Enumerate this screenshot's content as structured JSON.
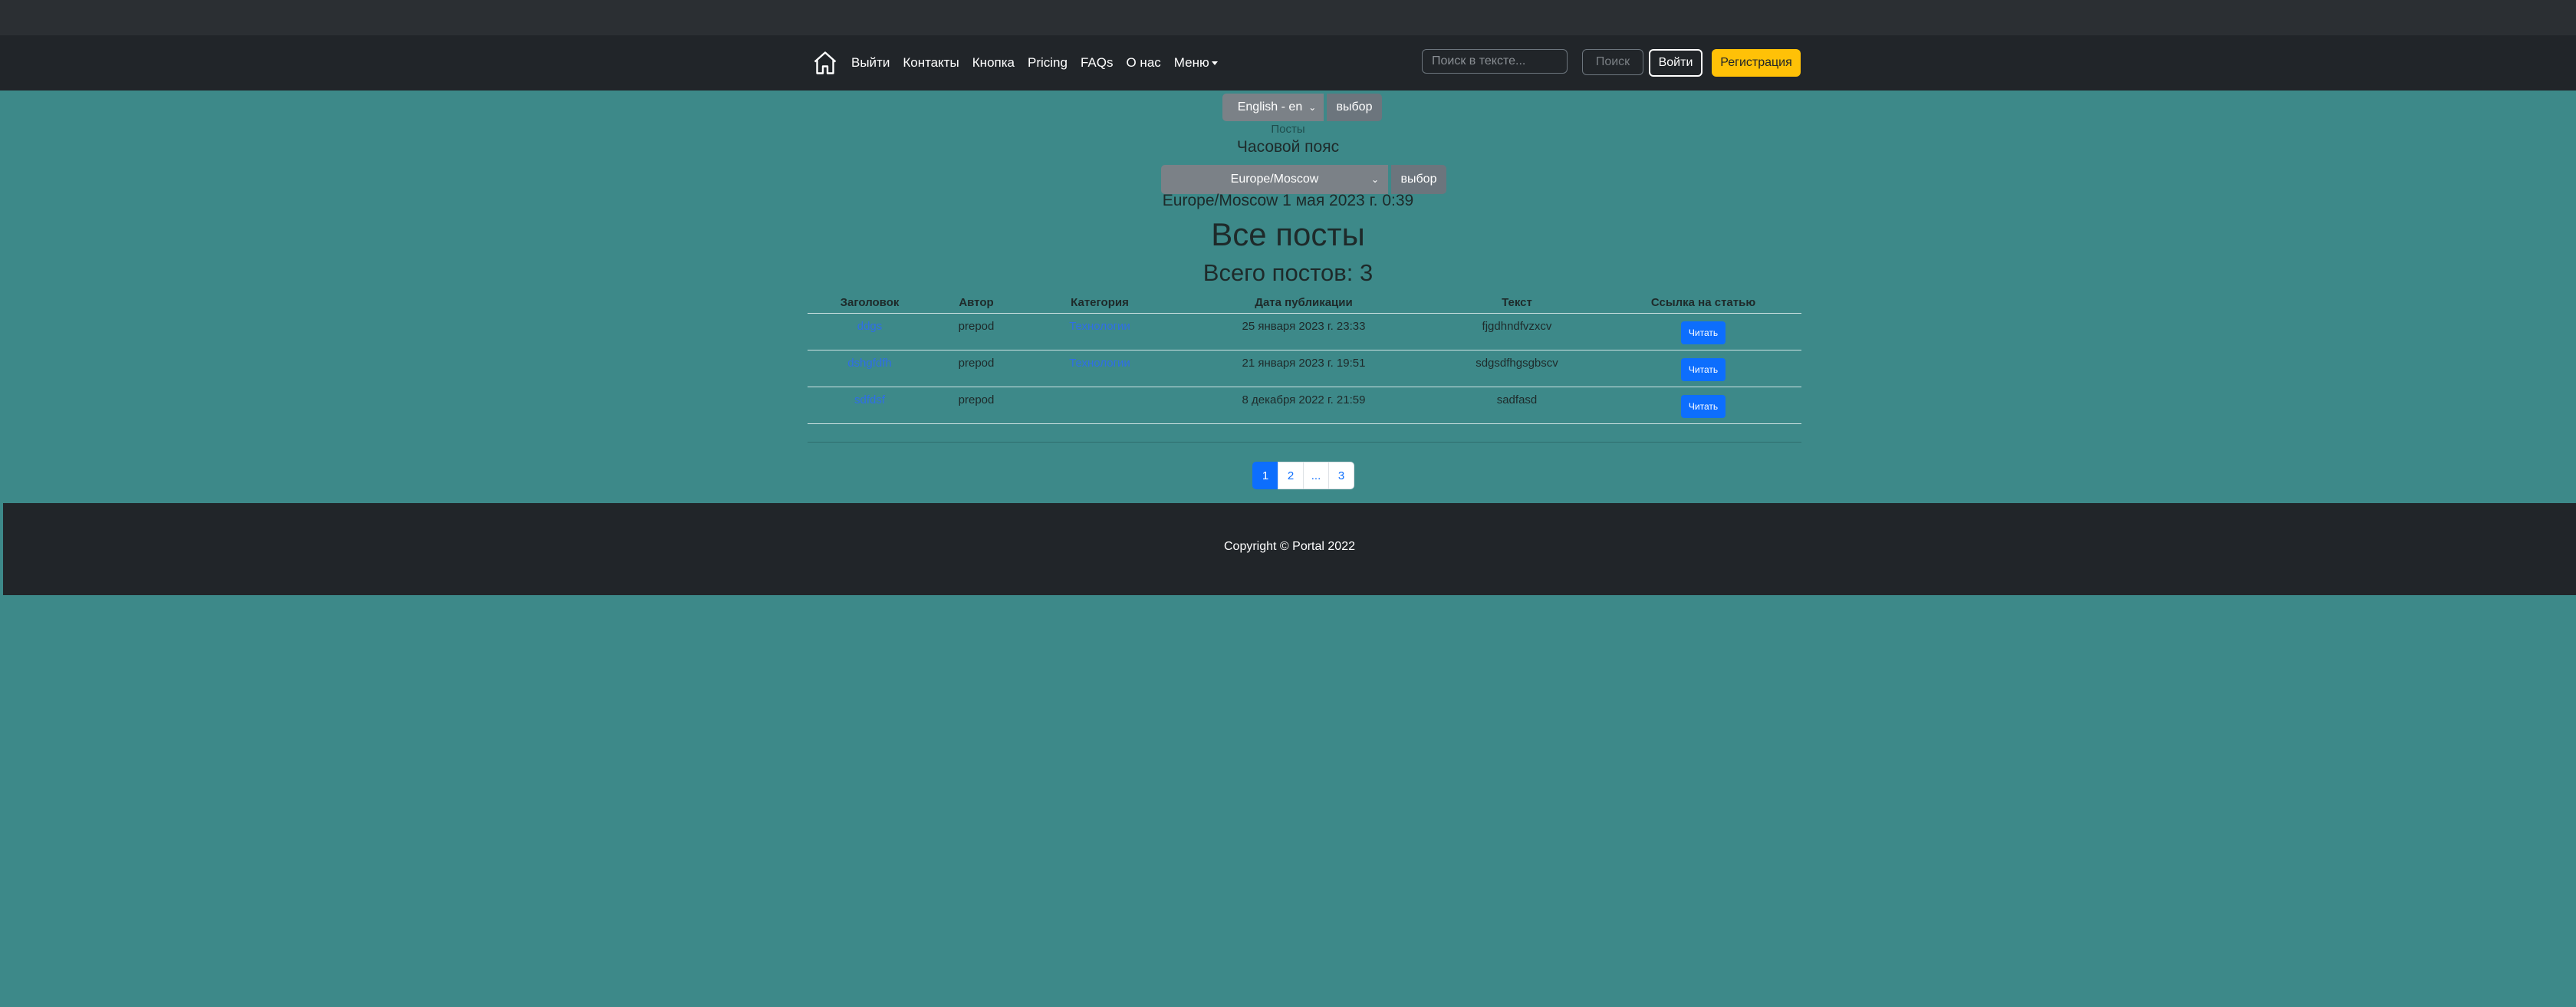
{
  "navbar": {
    "home_icon": "home-icon",
    "links": [
      {
        "label": "Выйти"
      },
      {
        "label": "Контакты"
      },
      {
        "label": "Кнопка"
      },
      {
        "label": "Pricing"
      },
      {
        "label": "FAQs"
      },
      {
        "label": "О нас"
      },
      {
        "label": "Меню"
      }
    ],
    "search_placeholder": "Поиск в тексте...",
    "search_button": "Поиск",
    "login_button": "Войти",
    "register_button": "Регистрация"
  },
  "language": {
    "selected": "English - en",
    "submit": "выбор"
  },
  "posts_link": "Посты",
  "timezone": {
    "title": "Часовой пояс",
    "selected": "Europe/Moscow",
    "submit": "выбор"
  },
  "current_datetime": "Europe/Moscow 1 мая 2023 г. 0:39",
  "page_title": "Все посты",
  "post_count": "Всего постов: 3",
  "table": {
    "headers": [
      "Заголовок",
      "Автор",
      "Категория",
      "Дата публикации",
      "Текст",
      "Ссылка на статью"
    ],
    "rows": [
      {
        "title": "ddgs",
        "author": "prepod",
        "category": "Технологии",
        "date": "25 января 2023 г. 23:33",
        "text": "fjgdhndfvzxcv",
        "link": "Читать"
      },
      {
        "title": "dshgfdfh",
        "author": "prepod",
        "category": "Технологии",
        "date": "21 января 2023 г. 19:51",
        "text": "sdgsdfhgsgbscv",
        "link": "Читать"
      },
      {
        "title": "sdfdsf",
        "author": "prepod",
        "category": "",
        "date": "8 декабря 2022 г. 21:59",
        "text": "sadfasd",
        "link": "Читать"
      }
    ]
  },
  "pagination": [
    "1",
    "2",
    "...",
    "3"
  ],
  "footer": {
    "copyright": "Copyright © Portal 2022"
  },
  "colors": {
    "background": "#3d8989",
    "navbar": "#212529",
    "accent": "#0d6efd",
    "register": "#ffc107"
  }
}
